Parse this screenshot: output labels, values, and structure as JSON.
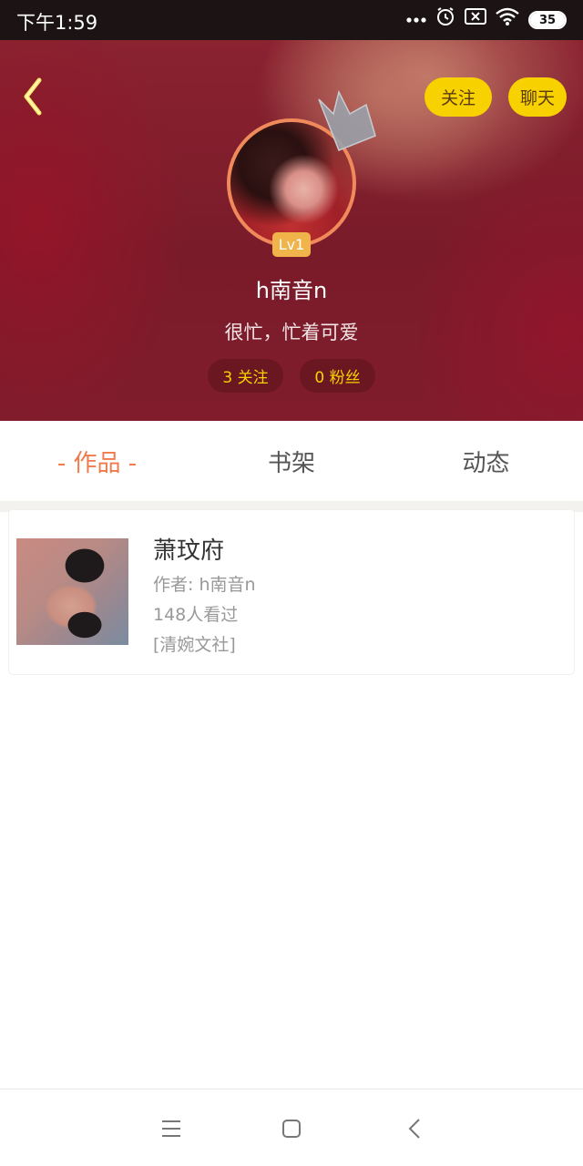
{
  "status_bar": {
    "time": "下午1:59",
    "battery": "35",
    "icons": [
      "more-dots-icon",
      "alarm-icon",
      "sim-blocked-icon",
      "wifi-icon",
      "battery-icon"
    ]
  },
  "header": {
    "follow_label": "关注",
    "chat_label": "聊天",
    "level": "Lv1",
    "username": "h南音n",
    "bio": "很忙，忙着可爱",
    "following": "3 关注",
    "fans": "0 粉丝",
    "accent_color": "#f8d100"
  },
  "tabs": [
    {
      "label": "- 作品 -",
      "active": true
    },
    {
      "label": "书架",
      "active": false
    },
    {
      "label": "动态",
      "active": false
    }
  ],
  "works": [
    {
      "title": "萧玟府",
      "author": "作者: h南音n",
      "views": "148人看过",
      "society": "[清婉文社]"
    }
  ],
  "colors": {
    "active_tab": "#f07a4a",
    "level_badge": "#f0b44a",
    "avatar_border": "#f08a5a"
  }
}
